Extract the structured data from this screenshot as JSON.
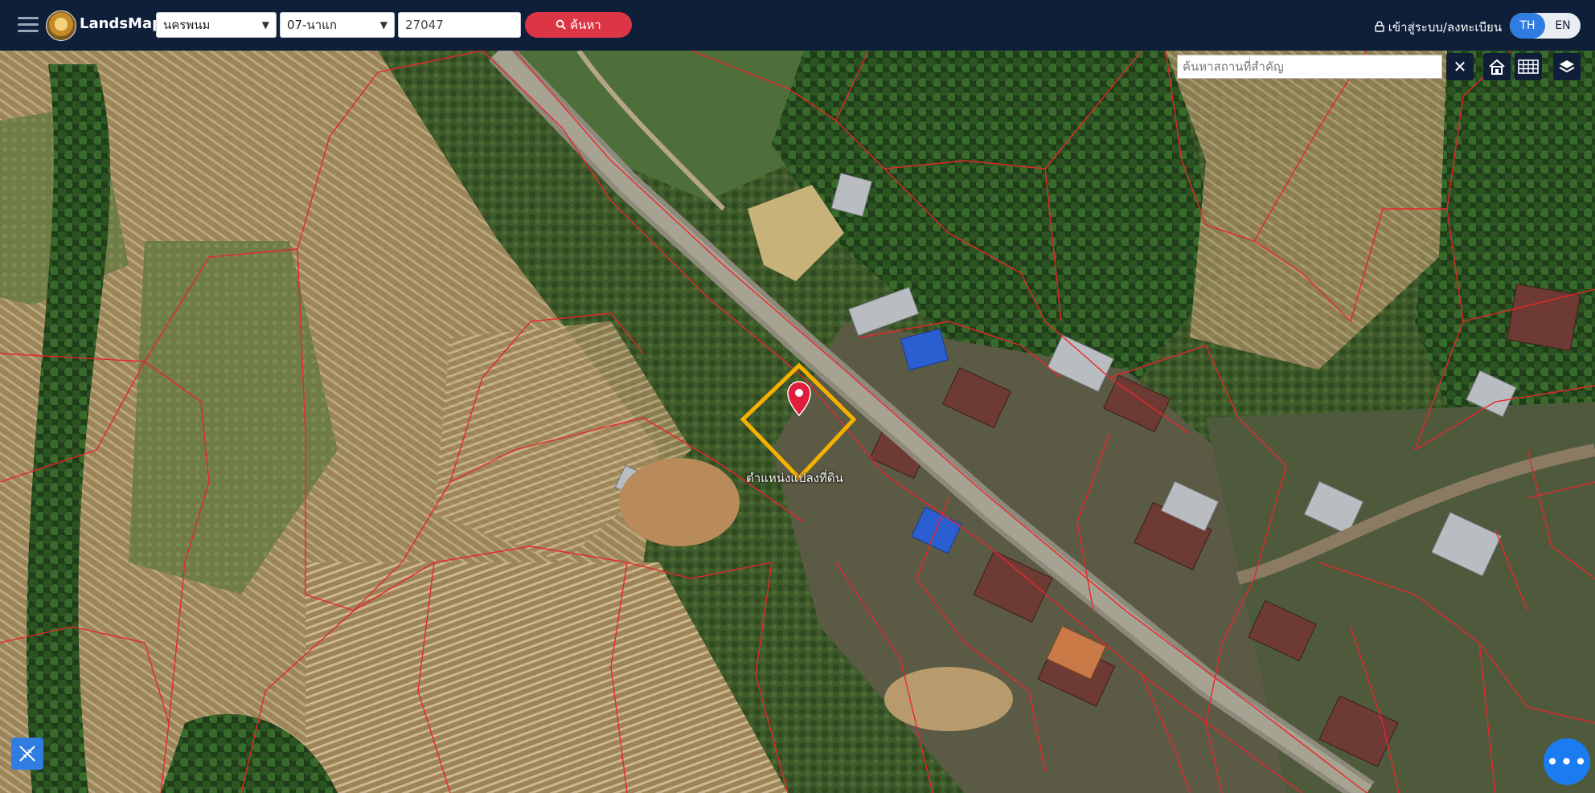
{
  "header": {
    "app_name": "LandsMaps",
    "province": "นครพนม",
    "amphoe": "07-นาแก",
    "parcel_no": "27047",
    "search_label": "ค้นหา",
    "login_label": "เข้าสู่ระบบ/ลงทะเบียน",
    "lang_th": "TH",
    "lang_en": "EN"
  },
  "map": {
    "place_search_placeholder": "ค้นหาสถานที่สำคัญ",
    "clear_label": "✕",
    "marker_label": "ตำแหน่งแปลงที่ดิน",
    "parcel_line_color": "#e8262b",
    "highlight_color": "#f5b000",
    "marker_color": "#e01e3c"
  },
  "icons": {
    "menu": "hamburger-icon",
    "search": "search-icon",
    "lock": "lock-icon",
    "home": "home-icon",
    "grid": "grid-icon",
    "layers": "layers-icon",
    "measure": "measure-tool-icon",
    "chat": "chat-icon"
  }
}
